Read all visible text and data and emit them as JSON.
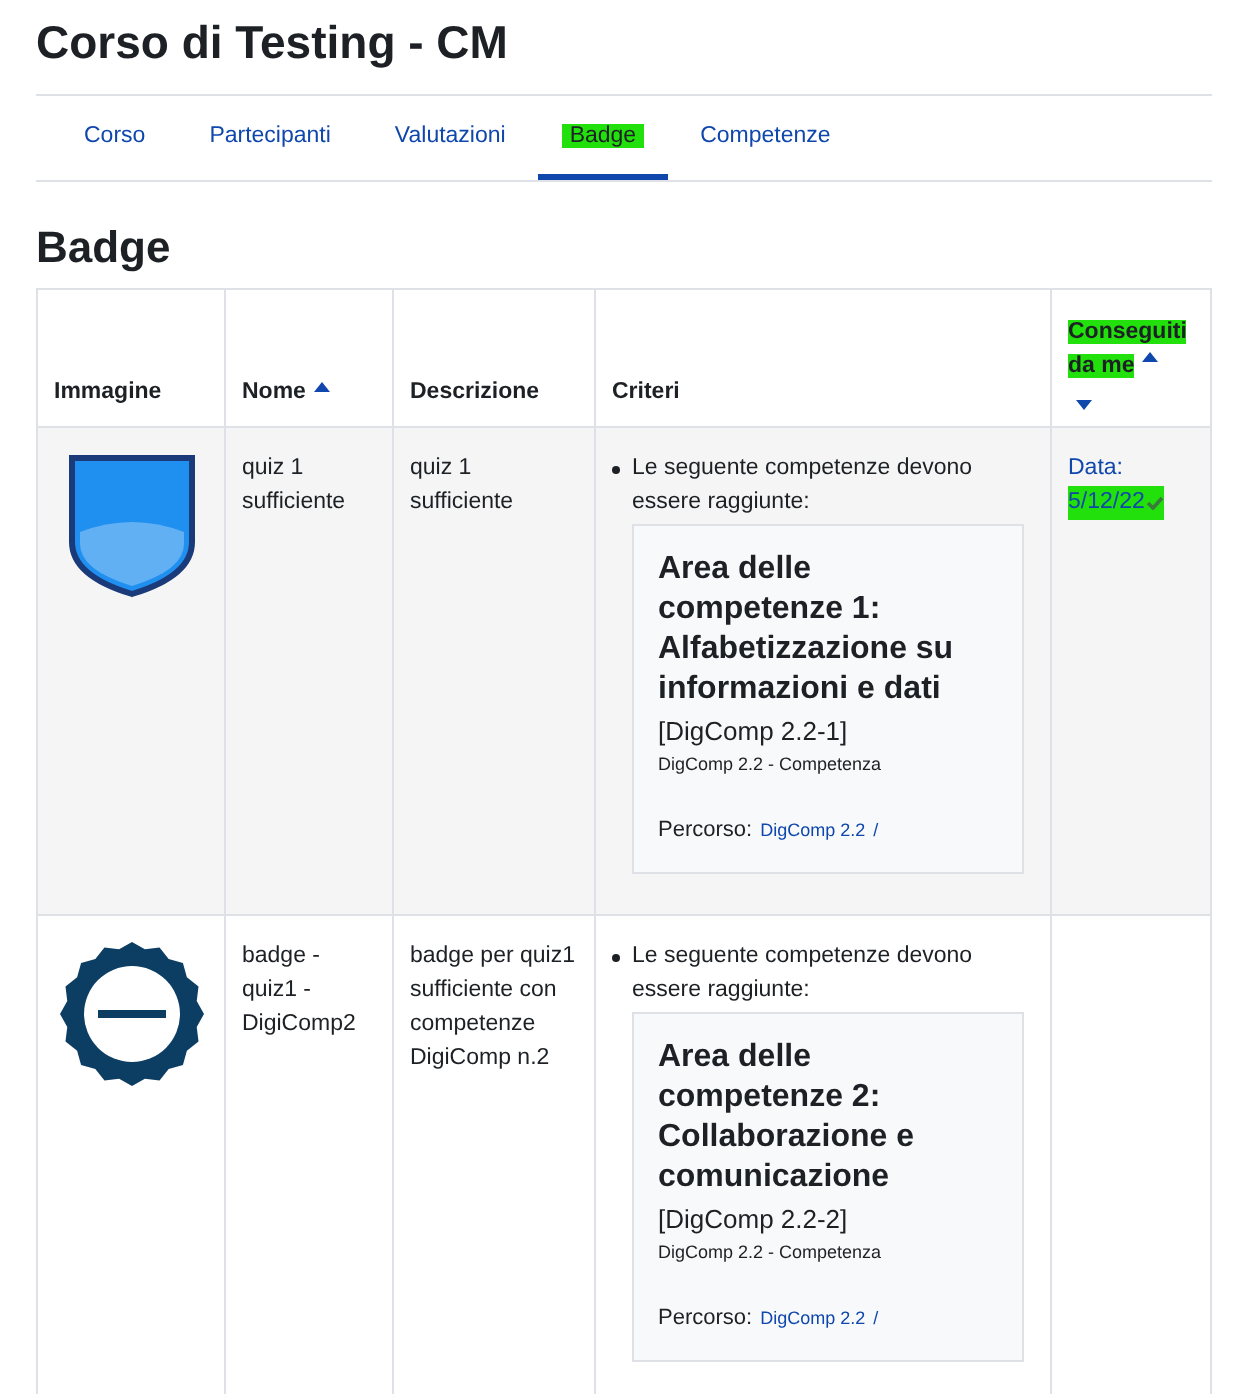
{
  "course_title": "Corso di Testing - CM",
  "tabs": [
    {
      "label": "Corso",
      "selected": false,
      "highlighted": false
    },
    {
      "label": "Partecipanti",
      "selected": false,
      "highlighted": false
    },
    {
      "label": "Valutazioni",
      "selected": false,
      "highlighted": false
    },
    {
      "label": "Badge",
      "selected": true,
      "highlighted": true
    },
    {
      "label": "Competenze",
      "selected": false,
      "highlighted": false
    }
  ],
  "section_title": "Badge",
  "table": {
    "columns": [
      {
        "label": "Immagine",
        "highlighted": false
      },
      {
        "label": "Nome",
        "sort_up": true,
        "highlighted": false
      },
      {
        "label": "Descrizione",
        "highlighted": false
      },
      {
        "label": "Criteri",
        "highlighted": false
      },
      {
        "label": "Conseguiti da me",
        "sort_up": true,
        "sort_down": true,
        "highlighted": true
      }
    ],
    "rows": [
      {
        "kind": "shield",
        "name": "quiz 1 sufficiente",
        "description": "quiz 1 sufficiente",
        "criteria_intro": "Le seguente competenze devono essere raggiunte:",
        "competency": {
          "title": "Area delle competenze 1: Alfabetizzazione su informazioni e dati",
          "code": "[DigComp 2.2-1]",
          "framework": "DigComp 2.2 - Competenza",
          "path_label": "Percorso:",
          "path_link": "DigComp 2.2",
          "path_sep": "/"
        },
        "earned": {
          "label": "Data:",
          "date": "5/12/22",
          "highlighted": true
        }
      },
      {
        "kind": "seal",
        "name": "badge - quiz1 - DigiComp2",
        "description": "badge per quiz1 sufficiente con competenze DigiComp n.2",
        "criteria_intro": "Le seguente competenze devono essere raggiunte:",
        "competency": {
          "title": "Area delle competenze 2: Collaborazione e comunicazione",
          "code": "[DigComp 2.2-2]",
          "framework": "DigComp 2.2 - Competenza",
          "path_label": "Percorso:",
          "path_link": "DigComp 2.2",
          "path_sep": "/"
        }
      }
    ]
  }
}
